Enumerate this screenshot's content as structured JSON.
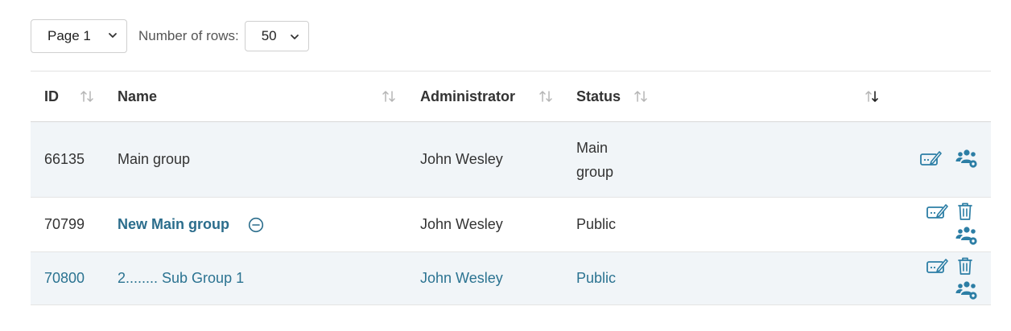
{
  "pagination": {
    "page_value": "Page 1",
    "rows_label": "Number of rows:",
    "rows_value": "50"
  },
  "table": {
    "columns": [
      "ID",
      "Name",
      "Administrator",
      "Status"
    ],
    "rows": [
      {
        "id": "66135",
        "name": "Main group",
        "administrator": "John Wesley",
        "status_line1": "Main",
        "status_line2": "group"
      },
      {
        "id": "70799",
        "name": "New Main group",
        "administrator": "John Wesley",
        "status": "Public"
      },
      {
        "id": "70800",
        "name": "2........ Sub Group 1",
        "administrator": "John Wesley",
        "status": "Public"
      }
    ]
  },
  "colors": {
    "accent": "#2b7391",
    "row_shade": "#f1f5f8",
    "icon": "#2c7ea5"
  }
}
